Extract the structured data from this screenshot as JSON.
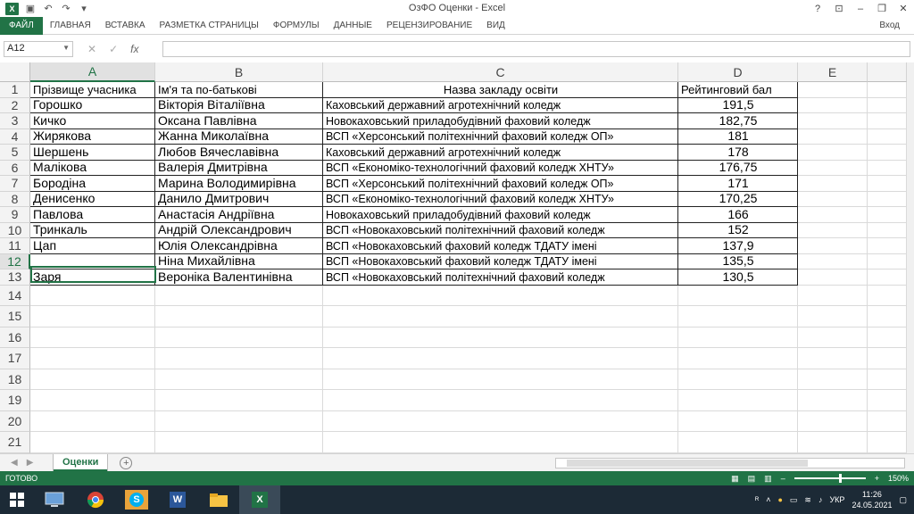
{
  "window": {
    "title": "ОзФО Оценки - Excel",
    "help": "?",
    "signin": "Вход"
  },
  "ribbon": {
    "file": "ФАЙЛ",
    "tabs": [
      "ГЛАВНАЯ",
      "ВСТАВКА",
      "РАЗМЕТКА СТРАНИЦЫ",
      "ФОРМУЛЫ",
      "ДАННЫЕ",
      "РЕЦЕНЗИРОВАНИЕ",
      "ВИД"
    ]
  },
  "formula_bar": {
    "name_box": "A12",
    "fx": "fx",
    "value": ""
  },
  "columns": [
    "A",
    "B",
    "C",
    "D",
    "E"
  ],
  "rows_numbers": [
    "1",
    "2",
    "3",
    "4",
    "5",
    "6",
    "7",
    "8",
    "9",
    "10",
    "11",
    "12",
    "13",
    "14",
    "15",
    "16",
    "17",
    "18",
    "19",
    "20",
    "21"
  ],
  "table": {
    "header": [
      "Прізвище учасника",
      "Ім'я та по-батькові",
      "Назва закладу освіти",
      "Рейтинговий бал"
    ],
    "rows": [
      [
        "Горошко",
        "Вікторія Віталіївна",
        "Каховський державний агротехнічний  коледж",
        "191,5"
      ],
      [
        "Кичко",
        "Оксана Павлівна",
        "Новокаховський приладобудівний   фаховий коледж",
        "182,75"
      ],
      [
        "Жирякова",
        "Жанна Миколаївна",
        "ВСП «Херсонський політехнічний фаховий коледж ОП»",
        "181"
      ],
      [
        "Шершень",
        "Любов Вячеславівна",
        "Каховський державний агротехнічний  коледж",
        "178"
      ],
      [
        "Малікова",
        "Валерія Дмитрівна",
        "ВСП «Економіко-технологічний фаховий коледж ХНТУ»",
        "176,75"
      ],
      [
        "Бородіна",
        "Марина Володимирівна",
        "ВСП «Херсонський політехнічний фаховий коледж ОП»",
        "171"
      ],
      [
        "Денисенко",
        "Данило Дмитрович",
        "ВСП «Економіко-технологічний фаховий коледж ХНТУ»",
        "170,25"
      ],
      [
        "Павлова",
        "Анастасія Андріївна",
        "Новокаховський приладобудівний фаховий коледж",
        "166"
      ],
      [
        "Тринкаль",
        "Андрій Олександрович",
        "ВСП «Новокаховський політехнічний фаховий коледж",
        "152"
      ],
      [
        "Цап",
        "Юлія Олександрівна",
        "ВСП «Новокаховський фаховий коледж ТДАТУ імені",
        "137,9"
      ],
      [
        "",
        "Ніна Михайлівна",
        "ВСП «Новокаховський фаховий коледж ТДАТУ імені",
        "135,5"
      ],
      [
        "Заря",
        "Вероніка Валентинівна",
        "ВСП «Новокаховський політехнічний фаховий коледж",
        "130,5"
      ]
    ]
  },
  "sheet_tabs": [
    "Оценки"
  ],
  "status": {
    "ready": "ГОТОВО",
    "zoom": "150%"
  },
  "taskbar": {
    "lang": "УКР",
    "time": "11:26",
    "date": "24.05.2021"
  }
}
